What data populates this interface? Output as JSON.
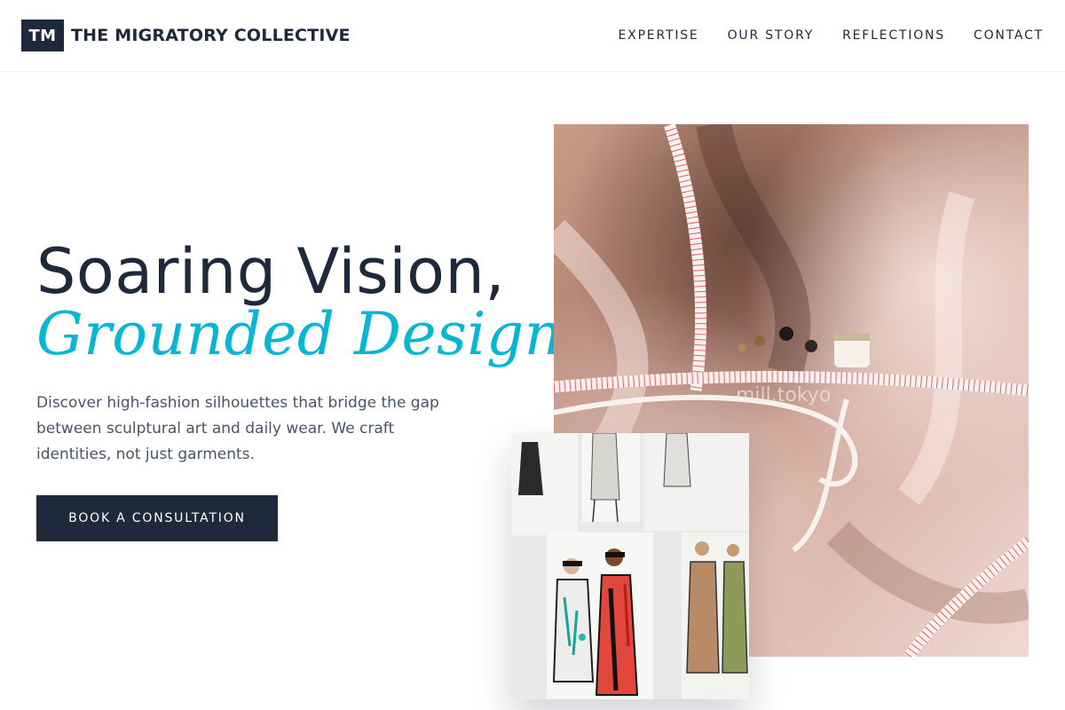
{
  "brand": {
    "logo_text": "TM",
    "name": "THE MIGRATORY COLLECTIVE"
  },
  "nav": {
    "items": [
      {
        "label": "EXPERTISE"
      },
      {
        "label": "OUR STORY"
      },
      {
        "label": "REFLECTIONS"
      },
      {
        "label": "CONTACT"
      }
    ]
  },
  "hero": {
    "title_line1": "Soaring Vision,",
    "title_line2": "Grounded Design.",
    "description": "Discover high-fashion silhouettes that bridge the gap between sculptural art and daily wear. We craft identities, not just garments.",
    "cta_label": "BOOK A CONSULTATION"
  },
  "images": {
    "main_photo_watermark": "mill.tokyo"
  },
  "colors": {
    "primary": "#1e293b",
    "accent": "#06b6d4",
    "body_text": "#475569"
  }
}
